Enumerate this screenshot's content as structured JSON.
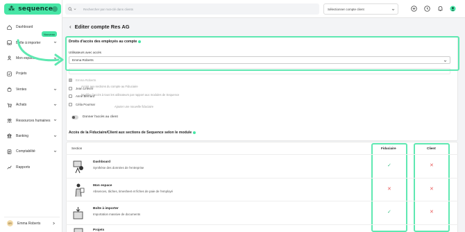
{
  "app": {
    "logo_mark": "⁂",
    "logo_text": "sequence"
  },
  "sidebar": {
    "items": [
      {
        "label": "Dashboard",
        "icon": "home-icon"
      },
      {
        "label": "Boîte à importer",
        "icon": "inbox-icon",
        "badge": "Nouveau"
      },
      {
        "label": "Mon espace",
        "icon": "user-icon"
      },
      {
        "label": "Projets",
        "icon": "check-square-icon"
      },
      {
        "label": "Ventes",
        "icon": "bag-icon"
      },
      {
        "label": "Achats",
        "icon": "cart-icon"
      },
      {
        "label": "Ressources humaines",
        "icon": "users-icon"
      },
      {
        "label": "Banking",
        "icon": "bank-icon"
      },
      {
        "label": "Comptabilité",
        "icon": "ledger-icon"
      },
      {
        "label": "Rapports",
        "icon": "chart-icon"
      }
    ],
    "user": {
      "initials": "ER",
      "name": "Emma Roberts"
    }
  },
  "topbar": {
    "search_placeholder": "Rechercher par mot-clé dans clients",
    "client_select": "Sélectionner compte client"
  },
  "page": {
    "title": "Editer compte Res AG",
    "rights_title": "Droits d'accès des employés au compte",
    "users_label": "Utilisateurs avec accès",
    "users_value": "Emma Roberts",
    "dropdown": [
      {
        "label": "Emma Roberts",
        "checked": true
      },
      {
        "label": "Jean Lefevre",
        "checked": false
      },
      {
        "label": "Anne Bernard",
        "checked": false
      },
      {
        "label": "Célia Pourmar",
        "checked": false
      }
    ],
    "ghost_section": "Accès aux sections du compte au Fiduciaire",
    "ghost_desc": "Modifier l'accès à tous les utilisateurs par rapport aux modules de Sequence",
    "ghost_button": "Ajouter une nouvelle fiduciaire",
    "toggle_label": "Donner l'accès au client",
    "sections_title": "Accès de la Fiduciaire/Client aux sections de Sequence selon le module",
    "table": {
      "col_section": "Section",
      "col_fiduciaire": "Fiduciaire",
      "col_client": "Client",
      "rows": [
        {
          "title": "Dashboard",
          "sub": "Synthèse des données de l'entreprise",
          "fiduciaire": true,
          "client": false
        },
        {
          "title": "Mon espace",
          "sub": "Absences, tâches, timesheet et fiches de paie de l'employé",
          "fiduciaire": false,
          "client": false
        },
        {
          "title": "Boîte à importer",
          "sub": "Importation massive de documents",
          "fiduciaire": true,
          "client": false
        },
        {
          "title": "Projets",
          "sub": "",
          "fiduciaire": null,
          "client": null
        }
      ]
    },
    "marks": {
      "ok": "✓",
      "no": "✕"
    }
  },
  "colors": {
    "accent": "#47e6a6",
    "ok": "#3bbf86",
    "no": "#e85a5a"
  }
}
